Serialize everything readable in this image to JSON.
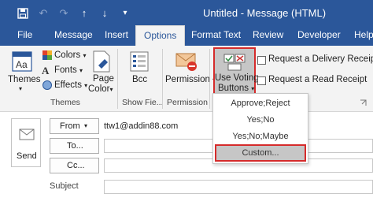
{
  "window": {
    "title": "Untitled - Message (HTML)",
    "qat": [
      {
        "name": "save-icon",
        "glyph": "💾"
      },
      {
        "name": "undo-icon",
        "glyph": "↶"
      },
      {
        "name": "redo-icon",
        "glyph": "↷"
      },
      {
        "name": "up-arrow-icon",
        "glyph": "↑"
      },
      {
        "name": "down-arrow-icon",
        "glyph": "↓"
      },
      {
        "name": "customize-qat-icon",
        "glyph": "▾"
      }
    ]
  },
  "tabs": [
    "File",
    "Message",
    "Insert",
    "Options",
    "Format Text",
    "Review",
    "Developer",
    "Help"
  ],
  "active_tab": "Options",
  "ribbon": {
    "themes_group": {
      "themes_label": "Themes",
      "colors_label": "Colors",
      "fonts_label": "Fonts",
      "effects_label": "Effects",
      "page_color_label_1": "Page",
      "page_color_label_2": "Color",
      "group_label": "Themes"
    },
    "show_fields_group": {
      "bcc_label": "Bcc",
      "group_label": "Show Fie..."
    },
    "permission_group": {
      "permission_label": "Permission",
      "group_label": "Permission"
    },
    "tracking_group": {
      "voting_label_1": "Use Voting",
      "voting_label_2": "Buttons",
      "delivery_receipt_label": "Request a Delivery Receipt",
      "read_receipt_label": "Request a Read Receipt"
    }
  },
  "voting_menu": {
    "items": [
      "Approve;Reject",
      "Yes;No",
      "Yes;No;Maybe",
      "Custom..."
    ],
    "highlighted": "Custom..."
  },
  "compose": {
    "send_label": "Send",
    "from_label": "From",
    "from_value": "ttw1@addin88.com",
    "to_label": "To...",
    "cc_label": "Cc...",
    "subject_label": "Subject"
  },
  "colors": {
    "accent": "#2b579a",
    "highlight_border": "#d52b2b"
  }
}
